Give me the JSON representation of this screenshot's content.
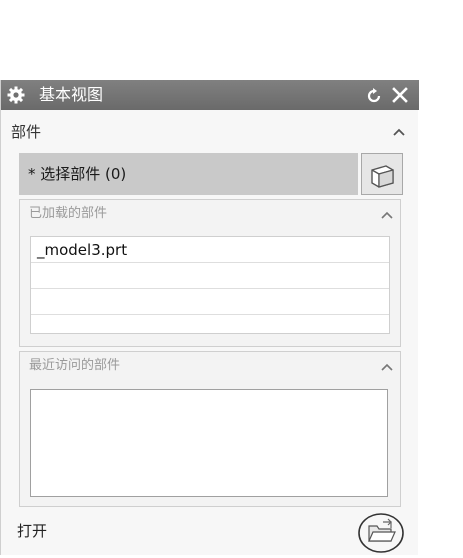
{
  "window": {
    "title": "基本视图",
    "reset_icon": "reset-icon",
    "close_icon": "close-icon",
    "settings_icon": "gear-icon"
  },
  "part_section": {
    "title": "部件",
    "select_label": "* 选择部件 (0)",
    "select_icon": "cube-icon"
  },
  "loaded_parts": {
    "title": "已加载的部件",
    "items": [
      "_model3.prt",
      "",
      "",
      ""
    ]
  },
  "recent_parts": {
    "title": "最近访问的部件",
    "items": []
  },
  "open": {
    "label": "打开",
    "icon": "open-folder-icon"
  }
}
